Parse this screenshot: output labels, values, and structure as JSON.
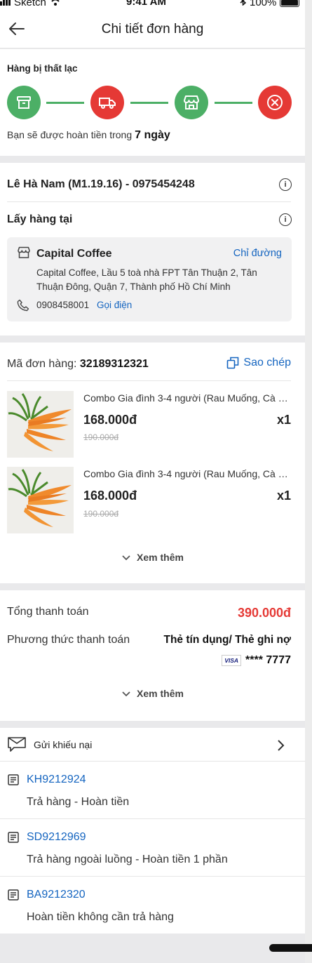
{
  "status_bar": {
    "carrier": "Sketch",
    "time": "9:41 AM",
    "battery": "100%"
  },
  "header": {
    "title": "Chi tiết đơn hàng"
  },
  "status": {
    "label": "Hàng bị thất lạc",
    "steps": [
      {
        "icon": "archive-box-icon",
        "state": "done",
        "color": "#4caf66"
      },
      {
        "icon": "delivery-truck-icon",
        "state": "active",
        "color": "#e53935"
      },
      {
        "icon": "store-icon",
        "state": "done",
        "color": "#4caf66"
      },
      {
        "icon": "close-circle-icon",
        "state": "failed",
        "color": "#e53935"
      }
    ],
    "refund_text": "Bạn sẽ được hoàn tiền trong",
    "refund_days": "7 ngày"
  },
  "customer": {
    "name_phone": "Lê Hà Nam (M1.19.16) - 0975454248"
  },
  "pickup": {
    "label": "Lấy hàng tại",
    "store_name": "Capital Coffee",
    "directions": "Chỉ đường",
    "address": "Capital Coffee, Lầu 5 toà nhà FPT Tân Thuận 2, Tân Thuận Đông, Quận 7, Thành phố Hồ Chí Minh",
    "phone": "0908458001",
    "call": "Gọi điện"
  },
  "order": {
    "code_label": "Mã đơn hàng:",
    "code": "32189312321",
    "copy_label": "Sao chép",
    "items": [
      {
        "name": "Combo Gia đình 3-4 người (Rau Muống, Cà R...",
        "price": "168.000đ",
        "old_price": "190.000đ",
        "qty": "x1"
      },
      {
        "name": "Combo Gia đình 3-4 người (Rau Muống, Cà R...",
        "price": "168.000đ",
        "old_price": "190.000đ",
        "qty": "x1"
      }
    ],
    "see_more": "Xem thêm"
  },
  "payment": {
    "total_label": "Tổng thanh toán",
    "total": "390.000đ",
    "method_label": "Phương thức thanh toán",
    "method": "Thẻ tín dụng/ Thẻ ghi nợ",
    "card_brand": "VISA",
    "card_number": "**** 7777",
    "see_more": "Xem thêm"
  },
  "complaints": {
    "label": "Gửi khiếu nại",
    "tickets": [
      {
        "id": "KH9212924",
        "desc": "Trả hàng - Hoàn tiền"
      },
      {
        "id": "SD9212969",
        "desc": "Trả hàng ngoài luồng - Hoàn tiền 1 phần"
      },
      {
        "id": "BA9212320",
        "desc": "Hoàn tiền không cần trả hàng"
      }
    ]
  },
  "colors": {
    "accent_blue": "#1565c0",
    "green": "#4caf66",
    "red": "#e53935"
  }
}
